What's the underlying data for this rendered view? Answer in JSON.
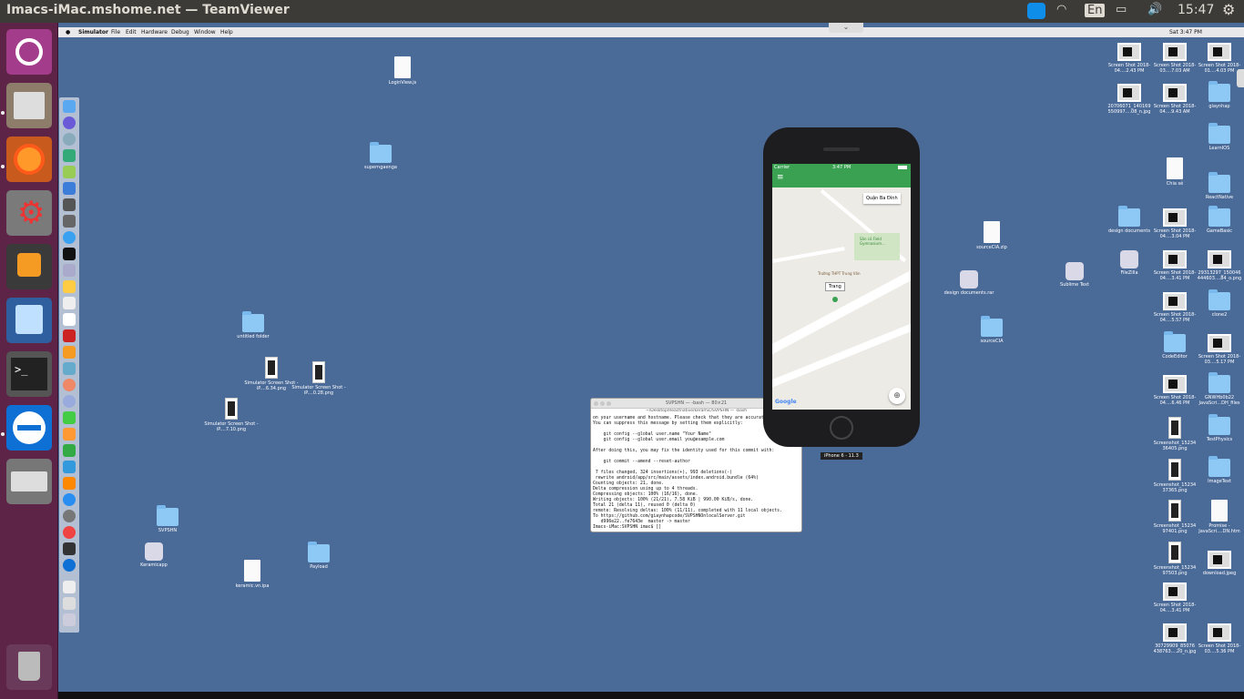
{
  "topbar": {
    "title": "Imacs-iMac.mshome.net — TeamViewer",
    "keyboard": "En",
    "clock": "15:47"
  },
  "mac_menu": {
    "app": "Simulator",
    "items": [
      "File",
      "Edit",
      "Hardware",
      "Debug",
      "Window",
      "Help"
    ],
    "right_status": "Sat 3:47 PM"
  },
  "desktop_left_icons": [
    {
      "label": "LoginView.js",
      "kind": "doc"
    },
    {
      "label": "superngaenga",
      "kind": "folder"
    },
    {
      "label": "untitled folder",
      "kind": "folder"
    },
    {
      "label": "Simulator Screen Shot - iP....6.34.png",
      "kind": "shotv"
    },
    {
      "label": "Simulator Screen Shot - iP....0.28.png",
      "kind": "shotv"
    },
    {
      "label": "Simulator Screen Shot - iP....7.10.png",
      "kind": "shotv"
    },
    {
      "label": "SVPSHN",
      "kind": "folder"
    },
    {
      "label": "Keramicapp",
      "kind": "app"
    },
    {
      "label": "keramic.vn.ipa",
      "kind": "doc"
    },
    {
      "label": "Payload",
      "kind": "folder"
    }
  ],
  "desktop_mid_icons": [
    {
      "label": "sourceCIA.zip",
      "kind": "doc"
    },
    {
      "label": "design documents.rar",
      "kind": "app"
    },
    {
      "label": "sourceCIA",
      "kind": "folder"
    },
    {
      "label": "Sublime Text",
      "kind": "app"
    }
  ],
  "desktop_right_icons": [
    {
      "label": "Screen Shot 2018-04....2.43 PM",
      "kind": "shot"
    },
    {
      "label": "Screen Shot 2018-03....7.03 AM",
      "kind": "shot"
    },
    {
      "label": "Screen Shot 2018-01....4.03 PM",
      "kind": "shot"
    },
    {
      "label": "20706071_140169 550997....08_n.jpg",
      "kind": "shot"
    },
    {
      "label": "Screen Shot 2018-04....9.43 AM",
      "kind": "shot"
    },
    {
      "label": "giaynhap",
      "kind": "folder"
    },
    {
      "label": "LearnIOS",
      "kind": "folder"
    },
    {
      "label": "Chia sẻ",
      "kind": "doc"
    },
    {
      "label": "ReactNative",
      "kind": "folder"
    },
    {
      "label": "design documents",
      "kind": "folder"
    },
    {
      "label": "Screen Shot 2018-04....3.04 PM",
      "kind": "shot"
    },
    {
      "label": "GameBasic",
      "kind": "folder"
    },
    {
      "label": "FileZilla",
      "kind": "app"
    },
    {
      "label": "Screen Shot 2018-04....3.41 PM",
      "kind": "shot"
    },
    {
      "label": "29313297_150046 444603....84_o.png",
      "kind": "shot"
    },
    {
      "label": "Screen Shot 2018-04....5.57 PM",
      "kind": "shot"
    },
    {
      "label": "clone2",
      "kind": "folder"
    },
    {
      "label": "CodeEditor",
      "kind": "folder"
    },
    {
      "label": "Screen Shot 2018-03....5.17 PM",
      "kind": "shot"
    },
    {
      "label": "Screen Shot 2018-04....6.46 PM",
      "kind": "shot"
    },
    {
      "label": "GNWHb0b22 JavaScri...DH_files",
      "kind": "folder"
    },
    {
      "label": "Screenshot_15234 36405.png",
      "kind": "shotv"
    },
    {
      "label": "TestPhysics",
      "kind": "folder"
    },
    {
      "label": "Screenshot_15234 37365.png",
      "kind": "shotv"
    },
    {
      "label": "ImageText",
      "kind": "folder"
    },
    {
      "label": "Screenshot_15234 97401.png",
      "kind": "shotv"
    },
    {
      "label": "Promise - JavaScri....DN.htm",
      "kind": "doc"
    },
    {
      "label": "Screenshot_15234 97503.png",
      "kind": "shotv"
    },
    {
      "label": "download.jpeg",
      "kind": "shot"
    },
    {
      "label": "Screen Shot 2018-04....3.41 PM",
      "kind": "shot"
    },
    {
      "label": "30729909_85076 438763....20_n.jpg",
      "kind": "shot"
    },
    {
      "label": "Screen Shot 2018-03....5.36 PM",
      "kind": "shot"
    }
  ],
  "simulator": {
    "carrier": "Carrier",
    "time": "3:47 PM",
    "place_name": "Quận Ba Đình",
    "poi_1": "Sân cỏ Field Gymnasium...",
    "poi_2": "Trường THPT Trung Văn",
    "pin_label": "Trang",
    "google": "Google",
    "device_label": "iPhone 6 - 11.3"
  },
  "terminal": {
    "title": "SVPSHN — -bash — 80×21",
    "path": "~/Desktop/Reactnative/keramic/SVPSHN — -bash",
    "lines": [
      "on your username and hostname. Please check that they are accurate.",
      "You can suppress this message by setting them explicitly:",
      "",
      "    git config --global user.name \"Your Name\"",
      "    git config --global user.email you@example.com",
      "",
      "After doing this, you may fix the identity used for this commit with:",
      "",
      "    git commit --amend --reset-author",
      "",
      " 7 files changed, 324 insertions(+), 993 deletions(-)",
      " rewrite android/app/src/main/assets/index.android.bundle (64%)",
      "Counting objects: 21, done.",
      "Delta compression using up to 4 threads.",
      "Compressing objects: 100% (16/16), done.",
      "Writing objects: 100% (21/21), 7.58 KiB | 990.00 KiB/s, done.",
      "Total 21 (delta 11), reused 0 (delta 0)",
      "remote: Resolving deltas: 100% (11/11), completed with 11 local objects.",
      "To https://github.com/giaynhapcode/SVPSHNOnlocalServer.git",
      "   d996e22..fe7643e  master -> master",
      "Imacs-iMac:SVPSHN imac$ []"
    ]
  }
}
